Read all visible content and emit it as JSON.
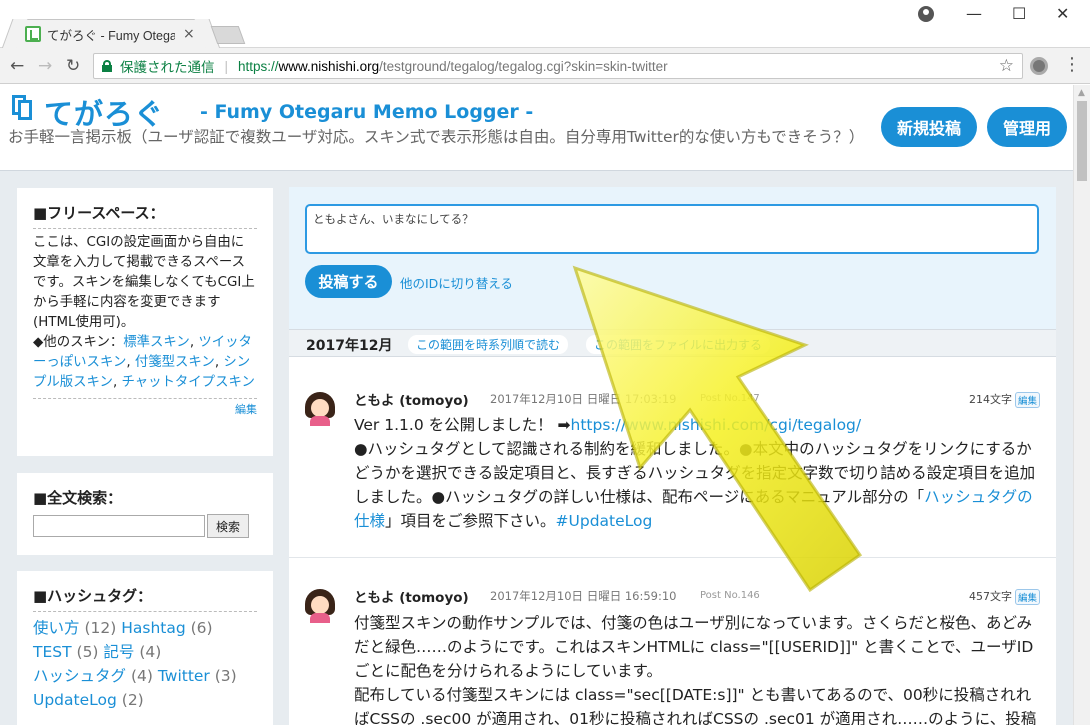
{
  "browser": {
    "tab_title": "てがろぐ - Fumy Otegaru Memo Logger",
    "tab_close": "×",
    "window_controls": {
      "minimize": "—",
      "maximize": "☐",
      "close": "✕"
    },
    "nav": {
      "back": "←",
      "forward": "→",
      "reload": "↻"
    },
    "secure_label": "保護された通信",
    "url_scheme": "https://",
    "url_host": "www.nishishi.org",
    "url_path": "/testground/tegalog/tegalog.cgi?skin=skin-twitter",
    "star": "☆",
    "menu": "⋮"
  },
  "header": {
    "title": "てがろぐ",
    "subtitle": "- Fumy Otegaru Memo Logger -",
    "description": "お手軽一言掲示板（ユーザ認証で複数ユーザ対応。スキン式で表示形態は自由。自分専用Twitter的な使い方もできそう？）",
    "new_post_label": "新規投稿",
    "admin_label": "管理用"
  },
  "sidebar": {
    "free": {
      "heading": "■フリースペース：",
      "text": "ここは、CGIの設定画面から自由に文章を入力して掲載できるスペースです。スキンを編集しなくてもCGI上から手軽に内容を変更できます(HTML使用可)。",
      "skins_prefix": "◆他のスキン：",
      "skins": [
        "標準スキン",
        "ツイッターっぽいスキン",
        "付箋型スキン",
        "シンプル版スキン",
        "チャットタイプスキン"
      ],
      "edit_label": "編集"
    },
    "search": {
      "heading": "■全文検索：",
      "value": "",
      "button_label": "検索"
    },
    "hashtags": {
      "heading": "■ハッシュタグ：",
      "items": [
        {
          "tag": "使い方",
          "count": "(12)"
        },
        {
          "tag": "Hashtag",
          "count": "(6)"
        },
        {
          "tag": "TEST",
          "count": "(5)"
        },
        {
          "tag": "記号",
          "count": "(4)"
        },
        {
          "tag": "ハッシュタグ",
          "count": "(4)"
        },
        {
          "tag": "Twitter",
          "count": "(3)"
        },
        {
          "tag": "UpdateLog",
          "count": "(2)"
        }
      ]
    }
  },
  "post_form": {
    "placeholder": "ともよさん、いまなにしてる？",
    "submit_label": "投稿する",
    "switch_id_label": "他のIDに切り替える"
  },
  "date_bar": {
    "label": "2017年12月",
    "link_chrono": "この範囲を時系列順で読む",
    "link_file": "この範囲をファイルに出力する"
  },
  "posts": [
    {
      "author": "ともよ (tomoyo)",
      "date": "2017年12月10日 日曜日 17:03:19",
      "no": "Post No.147",
      "chars": "214文字",
      "edit": "編集",
      "line1_text": "Ver 1.1.0 を公開しました！ ➡",
      "line1_link": "https://www.nishishi.com/cgi/tegalog/",
      "body_a": "●ハッシュタグとして認識される制約を緩和しました。●本文中のハッシュタグをリンクにするかどうかを選択できる設定項目と、長すぎるハッシュタグを指定文字数で切り詰める設定項目を追加しました。●ハッシュタグの詳しい仕様は、配布ページにあるマニュアル部分の「",
      "body_link": "ハッシュタグの仕様",
      "body_b": "」項目をご参照下さい。",
      "tag": "#UpdateLog"
    },
    {
      "author": "ともよ (tomoyo)",
      "date": "2017年12月10日 日曜日 16:59:10",
      "no": "Post No.146",
      "chars": "457文字",
      "edit": "編集",
      "body": "付箋型スキンの動作サンプルでは、付箋の色はユーザ別になっています。さくらだと桜色、あどみだと緑色……のようにです。これはスキンHTMLに class=\"[[USERID]]\" と書くことで、ユーザIDごとに配色を分けられるようにしています。",
      "body2": "配布している付箋型スキンには class=\"sec[[DATE:s]]\" とも書いてあるので、00秒に投稿されればCSSの .sec00 が適用され、01秒に投稿されればCSSの .sec01 が適用され……のように、投稿された秒数に応じて配色が変わるようにCSSを書いてあります。そのため、ランダムっぽく"
    }
  ],
  "colors": {
    "accent": "#1a8fd6",
    "page_bg": "#e7ecf0",
    "overlay_arrow": "#f5f020"
  },
  "overlay": {
    "icon": "arrow-up-left"
  }
}
